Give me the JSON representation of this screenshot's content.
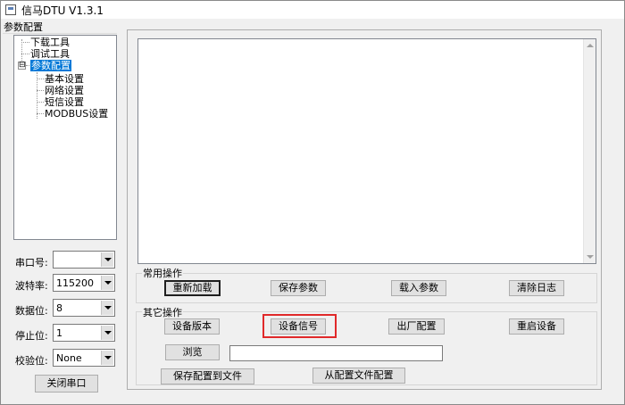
{
  "window": {
    "title": "信马DTU V1.3.1"
  },
  "left_panel": {
    "header": "参数配置",
    "tree": [
      {
        "label": "下载工具"
      },
      {
        "label": "调试工具"
      },
      {
        "label": "参数配置",
        "selected": true,
        "expander": "⊟"
      },
      {
        "label": "基本设置"
      },
      {
        "label": "网络设置"
      },
      {
        "label": "短信设置"
      },
      {
        "label": "MODBUS设置"
      }
    ]
  },
  "serial": {
    "port_label": "串口号:",
    "port_value": "",
    "baud_label": "波特率:",
    "baud_value": "115200",
    "databits_label": "数据位:",
    "databits_value": "8",
    "stopbits_label": "停止位:",
    "stopbits_value": "1",
    "parity_label": "校验位:",
    "parity_value": "None",
    "close_button": "关闭串口"
  },
  "common_ops": {
    "title": "常用操作",
    "reload": "重新加载",
    "save_params": "保存参数",
    "load_params": "载入参数",
    "clear_log": "清除日志"
  },
  "other_ops": {
    "title": "其它操作",
    "device_version": "设备版本",
    "device_signal": "设备信号",
    "factory_config": "出厂配置",
    "restart_device": "重启设备",
    "browse": "浏览",
    "file_path": "",
    "save_to_file": "保存配置到文件",
    "from_file": "从配置文件配置"
  },
  "colors": {
    "selection": "#0078d7",
    "highlight": "#e0292a"
  }
}
